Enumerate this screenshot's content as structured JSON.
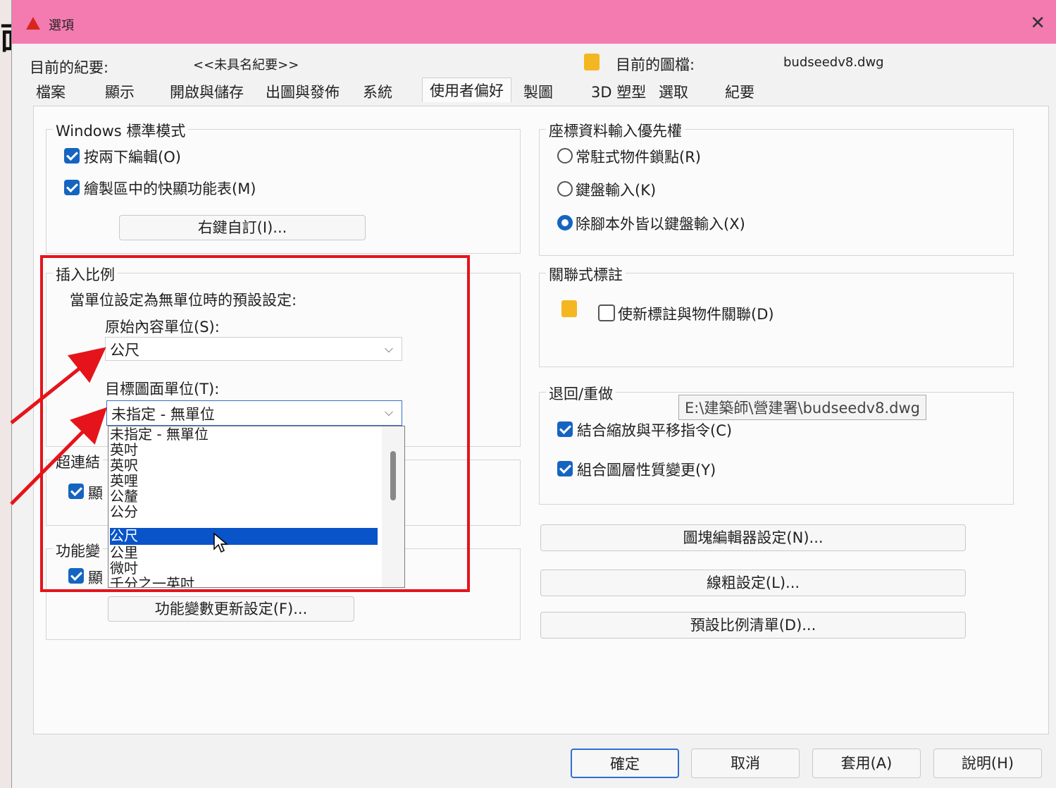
{
  "dialog": {
    "title": "選項",
    "current_profile_label": "目前的紀要:",
    "current_profile_value": "<<未具名紀要>>",
    "current_drawing_label": "目前的圖檔:",
    "current_drawing_value": "budseedv8.dwg"
  },
  "tabs": [
    {
      "label": "檔案"
    },
    {
      "label": "顯示"
    },
    {
      "label": "開啟與儲存"
    },
    {
      "label": "出圖與發佈"
    },
    {
      "label": "系統"
    },
    {
      "label": "使用者偏好"
    },
    {
      "label": "製圖"
    },
    {
      "label": "3D 塑型"
    },
    {
      "label": "選取"
    },
    {
      "label": "紀要"
    }
  ],
  "windows_mode": {
    "title": "Windows 標準模式",
    "dblclick_edit": "按兩下編輯(O)",
    "shortcut_menus": "繪製區中的快顯功能表(M)",
    "right_click_button": "右鍵自訂(I)..."
  },
  "insert_scale": {
    "title": "插入比例",
    "subtitle": "當單位設定為無單位時的預設設定:",
    "source_label": "原始內容單位(S):",
    "source_value": "公尺",
    "target_label": "目標圖面單位(T):",
    "target_value": "未指定 - 無單位",
    "options": [
      "未指定 - 無單位",
      "英吋",
      "英呎",
      "英哩",
      "公釐",
      "公分",
      "公尺",
      "公里",
      "微吋",
      "千分之一英吋"
    ],
    "selected_index": 6
  },
  "hyperlink": {
    "title": "超連結",
    "show_partial": "顯"
  },
  "fields": {
    "title": "功能變",
    "show_partial": "顯",
    "update_button": "功能變數更新設定(F)..."
  },
  "coord_priority": {
    "title": "座標資料輸入優先權",
    "opt1": "常駐式物件鎖點(R)",
    "opt2": "鍵盤輸入(K)",
    "opt3": "除腳本外皆以鍵盤輸入(X)"
  },
  "assoc_dim": {
    "title": "關聯式標註",
    "checkbox": "使新標註與物件關聯(D)"
  },
  "undo_redo": {
    "title": "退回/重做",
    "combine_zoom": "結合縮放與平移指令(C)",
    "combine_layer": "組合圖層性質變更(Y)"
  },
  "tooltip_path": "E:\\建築師\\營建署\\budseedv8.dwg",
  "right_buttons": {
    "block_editor": "圖塊編輯器設定(N)...",
    "lineweight": "線粗設定(L)...",
    "scale_list": "預設比例清單(D)..."
  },
  "bottom_buttons": {
    "ok": "確定",
    "cancel": "取消",
    "apply": "套用(A)",
    "help": "說明(H)"
  },
  "bg_glyph": "面",
  "colors": {
    "titlebar": "#f47bb0",
    "highlight": "#e5141b",
    "accent": "#1565c0"
  }
}
